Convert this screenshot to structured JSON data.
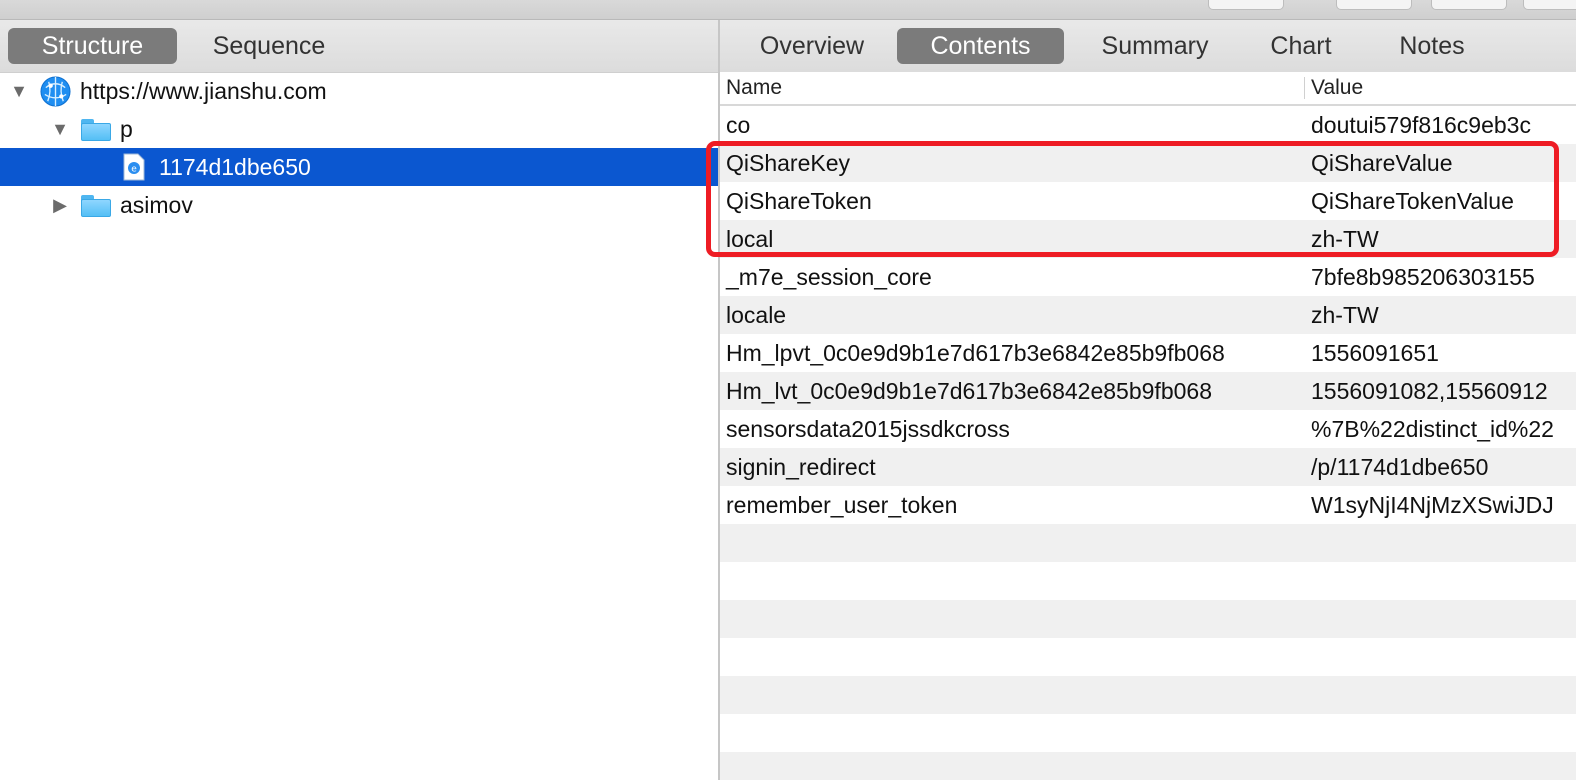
{
  "left_panel": {
    "tabs": [
      {
        "label": "Structure",
        "active": true
      },
      {
        "label": "Sequence",
        "active": false
      }
    ],
    "tree": [
      {
        "label": "https://www.jianshu.com",
        "icon": "globe-icon",
        "expanded": true
      },
      {
        "label": "p",
        "icon": "folder-icon",
        "expanded": true
      },
      {
        "label": "1174d1dbe650",
        "icon": "web-document-icon",
        "selected": true
      },
      {
        "label": "asimov",
        "icon": "folder-icon",
        "expanded": false
      }
    ]
  },
  "right_panel": {
    "tabs": [
      {
        "label": "Overview",
        "active": false
      },
      {
        "label": "Contents",
        "active": true
      },
      {
        "label": "Summary",
        "active": false
      },
      {
        "label": "Chart",
        "active": false
      },
      {
        "label": "Notes",
        "active": false
      }
    ],
    "columns": {
      "name": "Name",
      "value": "Value"
    },
    "rows": [
      {
        "name": "co",
        "value": "doutui579f816c9eb3c"
      },
      {
        "name": "QiShareKey",
        "value": "QiShareValue"
      },
      {
        "name": "QiShareToken",
        "value": "QiShareTokenValue"
      },
      {
        "name": "local",
        "value": "zh-TW"
      },
      {
        "name": "_m7e_session_core",
        "value": "7bfe8b985206303155"
      },
      {
        "name": "locale",
        "value": "zh-TW"
      },
      {
        "name": "Hm_lpvt_0c0e9d9b1e7d617b3e6842e85b9fb068",
        "value": "1556091651"
      },
      {
        "name": "Hm_lvt_0c0e9d9b1e7d617b3e6842e85b9fb068",
        "value": "1556091082,15560912"
      },
      {
        "name": "sensorsdata2015jssdkcross",
        "value": "%7B%22distinct_id%22"
      },
      {
        "name": "signin_redirect",
        "value": "/p/1174d1dbe650"
      },
      {
        "name": "remember_user_token",
        "value": "W1syNjI4NjMzXSwiJDJ"
      }
    ]
  },
  "colors": {
    "selection": "#0b57d0",
    "segment_active": "#7b7b7b",
    "highlight_box": "#ee1c24",
    "folder": "#54bff5"
  }
}
